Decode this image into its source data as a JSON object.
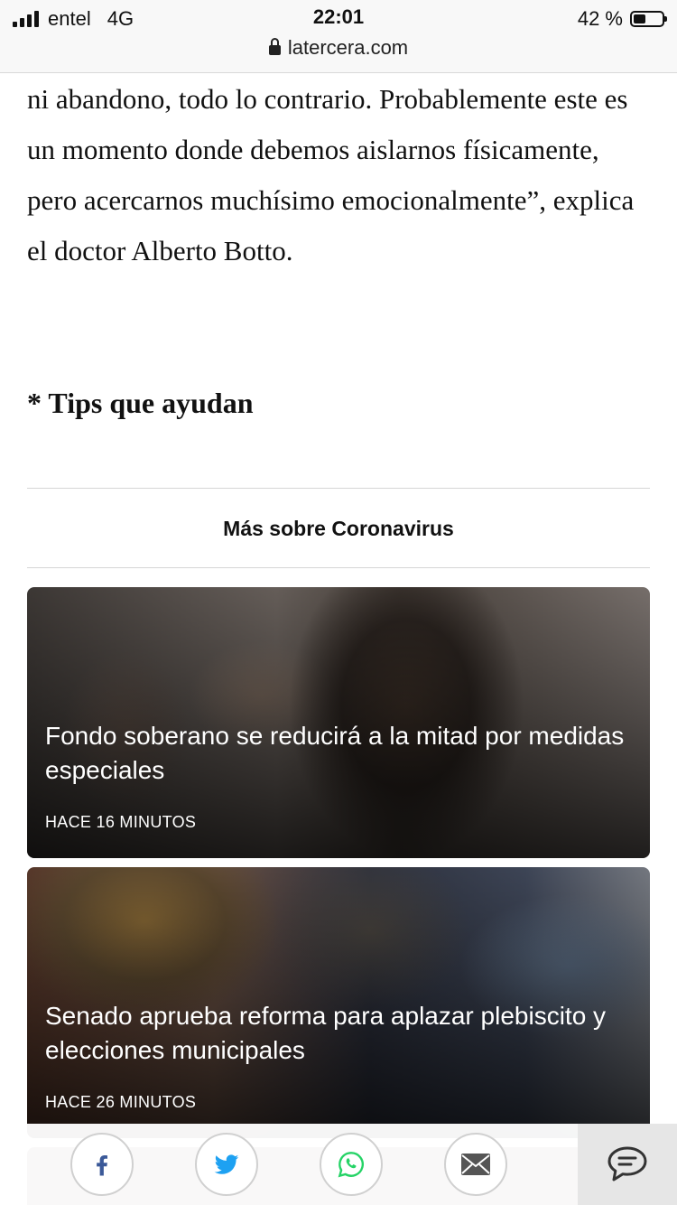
{
  "status_bar": {
    "carrier": "entel",
    "network": "4G",
    "time": "22:01",
    "battery": "42 %",
    "battery_level": 0.42
  },
  "browser": {
    "url": "latercera.com"
  },
  "article": {
    "paragraph": "ni abandono, todo lo contrario. Probablemente este es un momento donde debemos aislarnos físicamente, pero acercarnos muchísimo emocionalmente”, explica el doctor Alberto Botto.",
    "subheading": "* Tips que ayudan"
  },
  "more_section": {
    "title": "Más sobre Coronavirus",
    "cards": [
      {
        "title": "Fondo soberano se reducirá a la mitad por medidas especiales",
        "time": "HACE 16 MINUTOS"
      },
      {
        "title": "Senado aprueba reforma para aplazar plebiscito y elecciones municipales",
        "time": "HACE 26 MINUTOS"
      }
    ]
  },
  "share_bar": {
    "buttons": [
      {
        "icon": "facebook-icon",
        "color": "#3b5998"
      },
      {
        "icon": "twitter-icon",
        "color": "#1da1f2"
      },
      {
        "icon": "whatsapp-icon",
        "color": "#25d366"
      },
      {
        "icon": "mail-icon",
        "color": "#555555"
      }
    ],
    "comments_icon": "comment-icon"
  }
}
